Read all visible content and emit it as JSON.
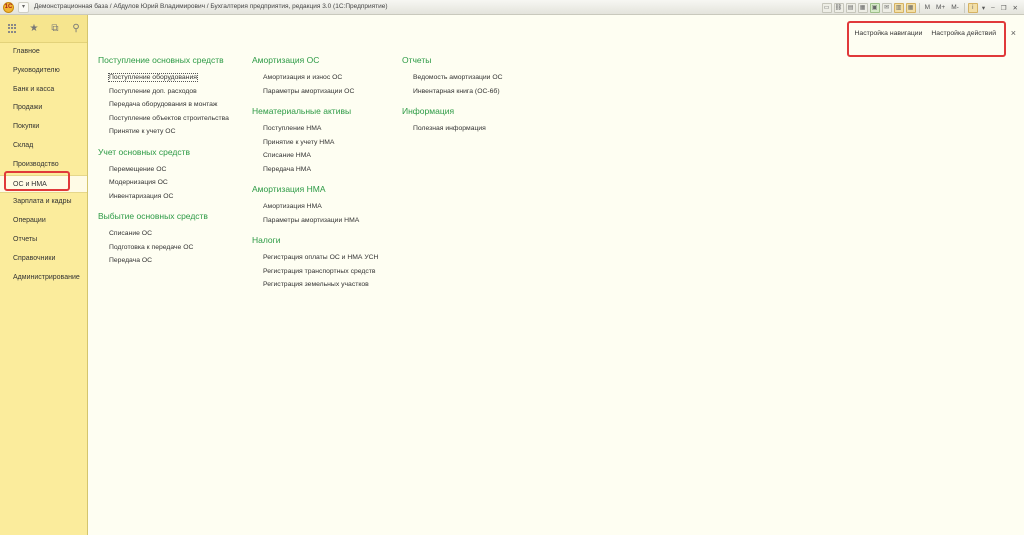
{
  "window": {
    "title": "Демонстрационная база / Абдулов Юрий Владимирович / Бухгалтерия предприятия, редакция 3.0  (1С:Предприятие)",
    "logo": "1С",
    "toolbar": {
      "m": "M",
      "m_plus": "M+",
      "m_minus": "M-"
    }
  },
  "sidebar": {
    "items": [
      {
        "label": "Главное"
      },
      {
        "label": "Руководителю"
      },
      {
        "label": "Банк и касса"
      },
      {
        "label": "Продажи"
      },
      {
        "label": "Покупки"
      },
      {
        "label": "Склад"
      },
      {
        "label": "Производство"
      },
      {
        "label": "ОС и НМА"
      },
      {
        "label": "Зарплата и кадры"
      },
      {
        "label": "Операции"
      },
      {
        "label": "Отчеты"
      },
      {
        "label": "Справочники"
      },
      {
        "label": "Администрирование"
      }
    ],
    "active_index": 7
  },
  "header": {
    "nav_settings": "Настройка навигации",
    "action_settings": "Настройка действий",
    "close": "×"
  },
  "columns": [
    {
      "sections": [
        {
          "title": "Поступление основных средств",
          "links": [
            "Поступление оборудования",
            "Поступление доп. расходов",
            "Передача оборудования в монтаж",
            "Поступление объектов строительства",
            "Принятие к учету ОС"
          ]
        },
        {
          "title": "Учет основных средств",
          "links": [
            "Перемещение ОС",
            "Модернизация ОС",
            "Инвентаризация ОС"
          ]
        },
        {
          "title": "Выбытие основных средств",
          "links": [
            "Списание ОС",
            "Подготовка к передаче ОС",
            "Передача ОС"
          ]
        }
      ]
    },
    {
      "sections": [
        {
          "title": "Амортизация ОС",
          "links": [
            "Амортизация и износ ОС",
            "Параметры амортизации ОС"
          ]
        },
        {
          "title": "Нематериальные активы",
          "links": [
            "Поступление НМА",
            "Принятие к учету НМА",
            "Списание НМА",
            "Передача НМА"
          ]
        },
        {
          "title": "Амортизация НМА",
          "links": [
            "Амортизация НМА",
            "Параметры амортизации НМА"
          ]
        },
        {
          "title": "Налоги",
          "links": [
            "Регистрация оплаты ОС и НМА УСН",
            "Регистрация транспортных средств",
            "Регистрация земельных участков"
          ]
        }
      ]
    },
    {
      "sections": [
        {
          "title": "Отчеты",
          "links": [
            "Ведомость амортизации ОС",
            "Инвентарная книга (ОС-6б)"
          ]
        },
        {
          "title": "Информация",
          "links": [
            "Полезная информация"
          ]
        }
      ]
    }
  ],
  "colors": {
    "accent_green": "#2c9a45",
    "sidebar_bg": "#fbec9c",
    "highlight_red": "#e0393a"
  }
}
